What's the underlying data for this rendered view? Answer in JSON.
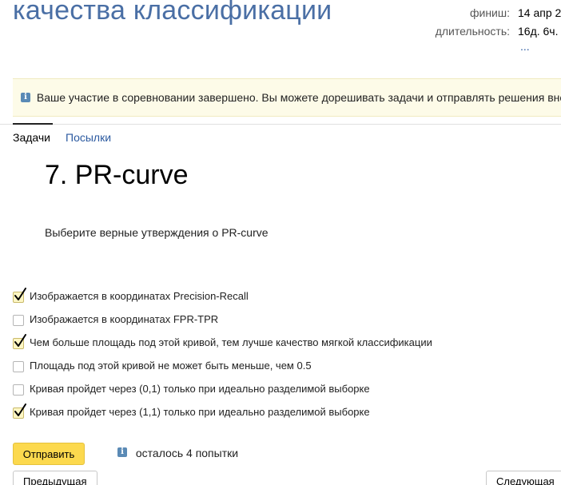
{
  "header": {
    "contest_title": "качества классификации",
    "meta": [
      {
        "label": "финиш:",
        "value": "14 апр 2"
      },
      {
        "label": "длительность:",
        "value": "16д. 6ч."
      }
    ],
    "more_link": "..."
  },
  "notice": {
    "icon": "info-icon",
    "text": "Ваше участие в соревновании завершено. Вы можете дорешивать задачи и отправлять решения вне"
  },
  "tabs": [
    {
      "label": "Задачи",
      "active": true
    },
    {
      "label": "Посылки",
      "active": false
    }
  ],
  "problem": {
    "title": "7. PR-curve",
    "statement": "Выберите верные утверждения о PR-curve",
    "options": [
      {
        "label": "Изображается в координатах Precision-Recall",
        "checked": true
      },
      {
        "label": "Изображается в координатах FPR-TPR",
        "checked": false
      },
      {
        "label": "Чем больше площадь под этой кривой, тем лучше качество мягкой классификации",
        "checked": true
      },
      {
        "label": "Площадь под этой кривой не может быть меньше, чем 0.5",
        "checked": false
      },
      {
        "label": "Кривая пройдет через (0,1) только при идеально разделимой выборке",
        "checked": false
      },
      {
        "label": "Кривая пройдет через (1,1) только при идеально разделимой выборке",
        "checked": true
      }
    ]
  },
  "actions": {
    "submit_label": "Отправить",
    "attempts_text": "осталось 4 попытки",
    "prev_label": "Предыдущая",
    "next_label": "Следующая"
  },
  "colors": {
    "title_blue": "#4a6fa5",
    "link_blue": "#2c5aa0",
    "submit_yellow": "#fcd94e",
    "notice_bg": "#fdfbe8",
    "info_icon": "#5a8ab5"
  }
}
